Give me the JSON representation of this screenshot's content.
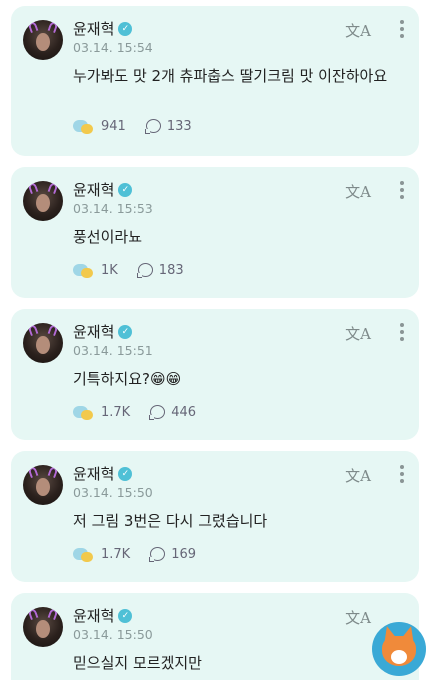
{
  "posts": [
    {
      "name": "윤재혁",
      "time": "03.14. 15:54",
      "text": "누가봐도 맛 2개 츄파춥스 딸기크림 맛 이잔하아요",
      "reactions": "941",
      "comments": "133"
    },
    {
      "name": "윤재혁",
      "time": "03.14. 15:53",
      "text": "풍선이라뇨",
      "reactions": "1K",
      "comments": "183"
    },
    {
      "name": "윤재혁",
      "time": "03.14. 15:51",
      "text": "기특하지요?😁😁",
      "reactions": "1.7K",
      "comments": "446"
    },
    {
      "name": "윤재혁",
      "time": "03.14. 15:50",
      "text": "저 그림 3번은 다시 그렸습니다",
      "reactions": "1.7K",
      "comments": "169"
    },
    {
      "name": "윤재혁",
      "time": "03.14. 15:50",
      "text": "믿으실지 모르겠지만",
      "reactions": "",
      "comments": ""
    }
  ],
  "icons": {
    "translate": "文A",
    "verified": "✓",
    "reaction": "bubble-reaction-icon",
    "comment": "comment-icon",
    "more": "more-vertical-icon"
  },
  "colors": {
    "card_bg": "#e6f7f4",
    "verified": "#4fc0d6",
    "watermark_fox_bg": "#3aa9d6"
  }
}
